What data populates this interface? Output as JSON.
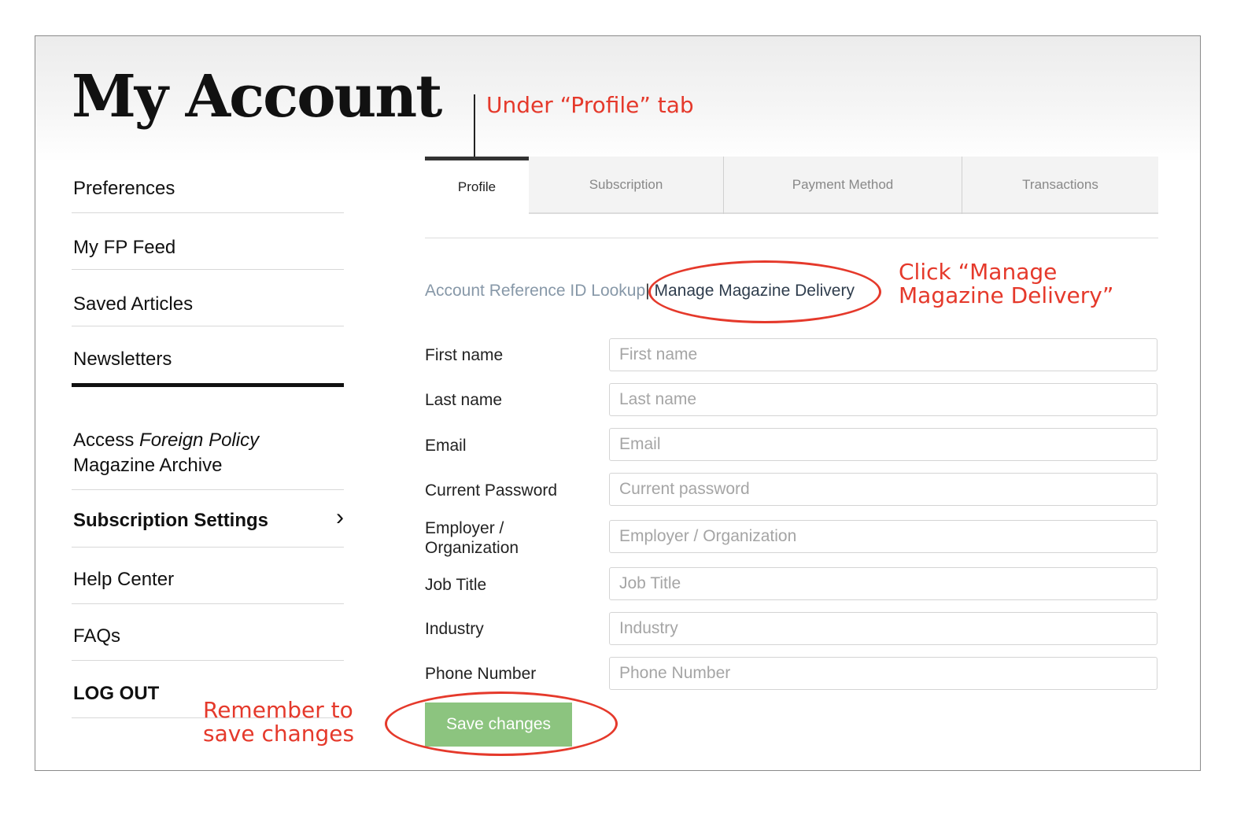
{
  "page": {
    "title": "My Account"
  },
  "sidebar": {
    "items": [
      {
        "label": "Preferences"
      },
      {
        "label": "My FP Feed"
      },
      {
        "label": "Saved Articles"
      },
      {
        "label": "Newsletters"
      },
      {
        "label_pre": "Access ",
        "label_em": "Foreign Policy",
        "label_post": " Magazine Archive"
      },
      {
        "label": "Subscription Settings",
        "chevron": "›"
      },
      {
        "label": "Help Center"
      },
      {
        "label": "FAQs"
      },
      {
        "label": "LOG OUT"
      }
    ]
  },
  "tabs": [
    {
      "label": "Profile",
      "active": true
    },
    {
      "label": "Subscription"
    },
    {
      "label": "Payment Method"
    },
    {
      "label": "Transactions"
    }
  ],
  "profile_links": {
    "lookup": "Account Reference ID Lookup",
    "separator": "|",
    "manage": "Manage Magazine Delivery"
  },
  "form": {
    "fields": [
      {
        "label": "First name",
        "placeholder": "First name",
        "value": ""
      },
      {
        "label": "Last name",
        "placeholder": "Last name",
        "value": ""
      },
      {
        "label": "Email",
        "placeholder": "Email",
        "value": ""
      },
      {
        "label": "Current Password",
        "placeholder": "Current password",
        "value": ""
      },
      {
        "label": "Employer / Organization",
        "placeholder": "Employer / Organization",
        "value": ""
      },
      {
        "label": "Job Title",
        "placeholder": "Job Title",
        "value": ""
      },
      {
        "label": "Industry",
        "placeholder": "Industry",
        "value": ""
      },
      {
        "label": "Phone Number",
        "placeholder": "Phone Number",
        "value": ""
      }
    ],
    "save_label": "Save changes"
  },
  "annotations": {
    "profile_tab": "Under “Profile” tab",
    "manage_line1": "Click “Manage",
    "manage_line2": "Magazine Delivery”",
    "save_line1": "Remember to",
    "save_line2": "save changes",
    "color": "#e5392b"
  },
  "colors": {
    "save_button": "#8cc47f",
    "link_muted": "#8798a8",
    "link_dark": "#2f3d4d"
  }
}
